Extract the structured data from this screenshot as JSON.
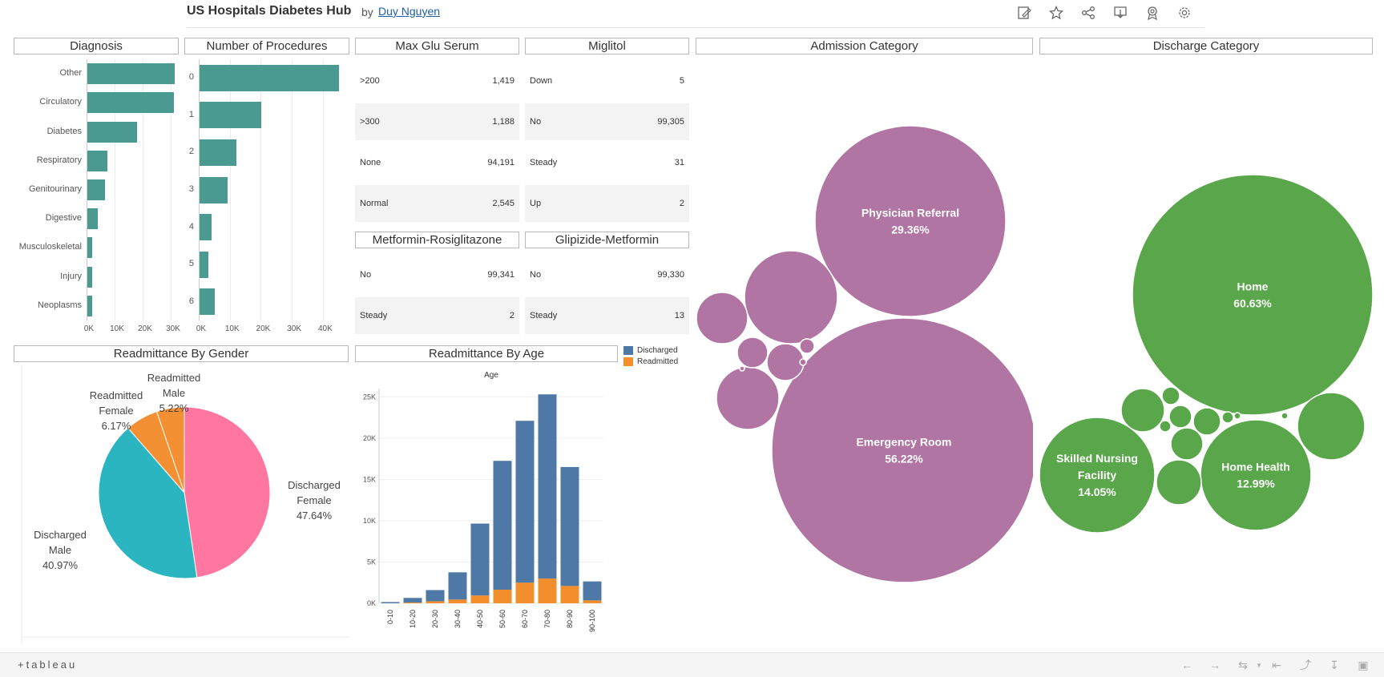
{
  "header": {
    "title": "US Hospitals Diabetes Hub",
    "by": "by",
    "author": "Duy Nguyen",
    "icons": [
      "edit-icon",
      "star-icon",
      "share-icon",
      "download-icon",
      "badge-icon",
      "gear-icon"
    ]
  },
  "panels": {
    "diagnosis": "Diagnosis",
    "procedures": "Number of Procedures",
    "max_glu": "Max Glu Serum",
    "miglitol": "Miglitol",
    "admission": "Admission Category",
    "discharge": "Discharge Category",
    "metformin_rosi": "Metformin-Rosiglitazone",
    "glipizide_met": "Glipizide-Metformin",
    "gender": "Readmittance By Gender",
    "age": "Readmittance By Age"
  },
  "tables": {
    "max_glu": [
      {
        "key": ">200",
        "value": "1,419"
      },
      {
        "key": ">300",
        "value": "1,188"
      },
      {
        "key": "None",
        "value": "94,191"
      },
      {
        "key": "Normal",
        "value": "2,545"
      }
    ],
    "miglitol": [
      {
        "key": "Down",
        "value": "5"
      },
      {
        "key": "No",
        "value": "99,305"
      },
      {
        "key": "Steady",
        "value": "31"
      },
      {
        "key": "Up",
        "value": "2"
      }
    ],
    "metformin_rosi": [
      {
        "key": "No",
        "value": "99,341"
      },
      {
        "key": "Steady",
        "value": "2"
      }
    ],
    "glipizide_met": [
      {
        "key": "No",
        "value": "99,330"
      },
      {
        "key": "Steady",
        "value": "13"
      }
    ]
  },
  "colors": {
    "teal_bar": "#4a9a91",
    "purple": "#b075a3",
    "green": "#5aa64a",
    "blue": "#4e79a7",
    "orange": "#f28e2b",
    "pink": "#ff77a0",
    "cyan": "#2bb5c1",
    "pie_orange": "#f39033"
  },
  "chart_data": [
    {
      "type": "bar",
      "orientation": "horizontal",
      "title": "Diagnosis",
      "categories": [
        "Other",
        "Circulatory",
        "Diabetes",
        "Respiratory",
        "Genitourinary",
        "Digestive",
        "Musculoskeletal",
        "Injury",
        "Neoplasms"
      ],
      "values": [
        31000,
        30800,
        17600,
        7000,
        6300,
        3800,
        1700,
        1600,
        1700
      ],
      "xticks": [
        "0K",
        "10K",
        "20K",
        "30K"
      ],
      "xlim": [
        0,
        32000
      ]
    },
    {
      "type": "bar",
      "orientation": "horizontal",
      "title": "Number of Procedures",
      "categories": [
        "0",
        "1",
        "2",
        "3",
        "4",
        "5",
        "6"
      ],
      "values": [
        45000,
        20000,
        12000,
        9000,
        3800,
        2800,
        4800
      ],
      "xticks": [
        "0K",
        "10K",
        "20K",
        "30K",
        "40K"
      ],
      "xlim": [
        0,
        47000
      ]
    },
    {
      "type": "pie",
      "title": "Readmittance By Gender",
      "slices": [
        {
          "label": "Discharged Female",
          "value": 47.64,
          "text": "47.64%"
        },
        {
          "label": "Discharged Male",
          "value": 40.97,
          "text": "40.97%"
        },
        {
          "label": "Readmitted Female",
          "value": 6.17,
          "text": "6.17%"
        },
        {
          "label": "Readmitted Male",
          "value": 5.22,
          "text": "5.22%"
        }
      ]
    },
    {
      "type": "bar",
      "stacked": true,
      "title": "Readmittance By Age",
      "xlabel": "Age",
      "categories": [
        "0-10",
        "10-20",
        "20-30",
        "30-40",
        "40-50",
        "50-60",
        "60-70",
        "70-80",
        "80-90",
        "90-100"
      ],
      "series": [
        {
          "name": "Readmitted",
          "values": [
            0,
            100,
            250,
            450,
            950,
            1650,
            2500,
            3000,
            2100,
            350
          ]
        },
        {
          "name": "Discharged",
          "values": [
            150,
            550,
            1350,
            3300,
            8700,
            15600,
            19600,
            22300,
            14400,
            2300
          ]
        }
      ],
      "yticks": [
        "0K",
        "5K",
        "10K",
        "15K",
        "20K",
        "25K"
      ],
      "ylim": [
        0,
        26000
      ]
    },
    {
      "type": "bubble",
      "title": "Admission Category",
      "bubbles": [
        {
          "label": "Emergency Room",
          "pct": "56.22%"
        },
        {
          "label": "Physician Referral",
          "pct": "29.36%"
        }
      ]
    },
    {
      "type": "bubble",
      "title": "Discharge Category",
      "bubbles": [
        {
          "label": "Home",
          "pct": "60.63%"
        },
        {
          "label": "Skilled Nursing Facility",
          "pct": "14.05%"
        },
        {
          "label": "Home Health",
          "pct": "12.99%"
        }
      ]
    }
  ],
  "footer": {
    "brand": "+tableau"
  }
}
